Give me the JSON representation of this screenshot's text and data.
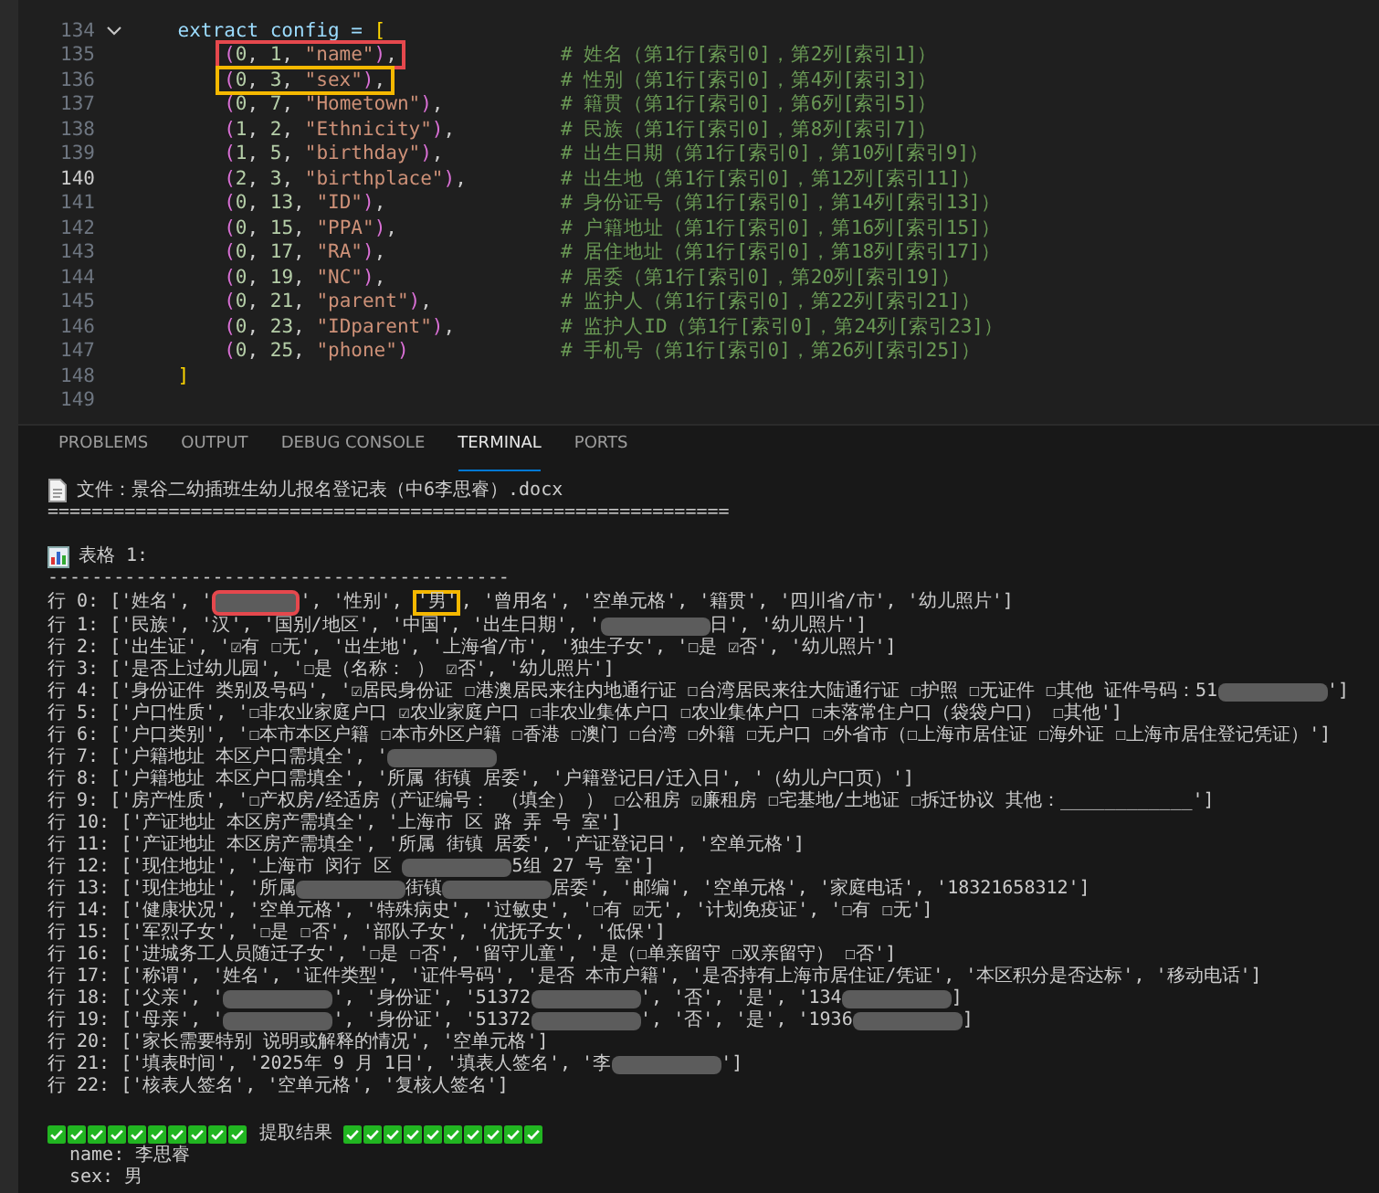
{
  "editor": {
    "lines": [
      {
        "number": "134",
        "code": "    extract_config = [",
        "foldable": true,
        "current": false
      },
      {
        "number": "135",
        "boxed": "(0, 1, \"name\"),",
        "color": "#e5484d",
        "comment": "# 姓名（第1行[索引0]，第2列[索引1]）",
        "current": false
      },
      {
        "number": "136",
        "boxed": "(0, 3, \"sex\"),",
        "color": "#f5b800",
        "comment": "# 性别（第1行[索引0]，第4列[索引3]）",
        "current": false
      },
      {
        "number": "137",
        "code": "        (0, 7, \"Hometown\"),",
        "comment": "# 籍贯（第1行[索引0]，第6列[索引5]）",
        "current": false
      },
      {
        "number": "138",
        "code": "        (1, 2, \"Ethnicity\"),",
        "comment": "# 民族（第1行[索引0]，第8列[索引7]）",
        "current": false
      },
      {
        "number": "139",
        "code": "        (1, 5, \"birthday\"),",
        "comment": "# 出生日期（第1行[索引0]，第10列[索引9]）",
        "current": false
      },
      {
        "number": "140",
        "code": "        (2, 3, \"birthplace\"),",
        "comment": "# 出生地（第1行[索引0]，第12列[索引11]）",
        "current": true
      },
      {
        "number": "141",
        "code": "        (0, 13, \"ID\"),",
        "comment": "# 身份证号（第1行[索引0]，第14列[索引13]）",
        "current": false
      },
      {
        "number": "142",
        "code": "        (0, 15, \"PPA\"),",
        "comment": "# 户籍地址（第1行[索引0]，第16列[索引15]）",
        "current": false
      },
      {
        "number": "143",
        "code": "        (0, 17, \"RA\"),",
        "comment": "# 居住地址（第1行[索引0]，第18列[索引17]）",
        "current": false
      },
      {
        "number": "144",
        "code": "        (0, 19, \"NC\"),",
        "comment": "# 居委（第1行[索引0]，第20列[索引19]）",
        "current": false
      },
      {
        "number": "145",
        "code": "        (0, 21, \"parent\"),",
        "comment": "# 监护人（第1行[索引0]，第22列[索引21]）",
        "current": false
      },
      {
        "number": "146",
        "code": "        (0, 23, \"IDparent\"),",
        "comment": "# 监护人ID（第1行[索引0]，第24列[索引23]）",
        "current": false
      },
      {
        "number": "147",
        "code": "        (0, 25, \"phone\")",
        "comment": "# 手机号（第1行[索引0]，第26列[索引25]）",
        "current": false
      },
      {
        "number": "148",
        "code": "    ]",
        "current": false
      },
      {
        "number": "149",
        "current": false
      }
    ]
  },
  "panel": {
    "tabs": [
      {
        "label": "PROBLEMS",
        "selected": false
      },
      {
        "label": "OUTPUT",
        "selected": false
      },
      {
        "label": "DEBUG CONSOLE",
        "selected": false
      },
      {
        "label": "TERMINAL",
        "selected": true
      },
      {
        "label": "PORTS",
        "selected": false
      }
    ]
  },
  "terminal": {
    "file_line": "文件：景谷二幼插班生幼儿报名登记表（中6李思睿）.docx",
    "double_rule": "==============================================================",
    "table_title": "表格 1:",
    "single_rule": "------------------------------------------",
    "lines": [
      {
        "parts": [
          {
            "kind": "text",
            "text": "行 0: ['姓名', '"
          },
          {
            "kind": "redacted",
            "color": "#e5484d"
          },
          {
            "kind": "text",
            "text": "', '性别', "
          },
          {
            "kind": "text",
            "text": "'男'",
            "color": "#f5b800"
          },
          {
            "kind": "text",
            "text": ", '曾用名', '空单元格', '籍贯', '四川省/市', '幼儿照片']"
          }
        ]
      },
      {
        "parts": [
          {
            "kind": "text",
            "text": "行 1: ['民族', '汉', '国别/地区', '中国', '出生日期', '"
          },
          {
            "kind": "redacted"
          },
          {
            "kind": "text",
            "text": "日', '幼儿照片']"
          }
        ]
      },
      {
        "parts": [
          {
            "kind": "text",
            "text": "行 2: ['出生证', '☑有 ☐无', '出生地', '上海省/市', '独生子女', '☐是 ☑否', '幼儿照片']"
          }
        ]
      },
      {
        "parts": [
          {
            "kind": "text",
            "text": "行 3: ['是否上过幼儿园', '☐是（名称： ） ☑否', '幼儿照片']"
          }
        ]
      },
      {
        "parts": [
          {
            "kind": "text",
            "text": "行 4: ['身份证件 类别及号码', '☑居民身份证 ☐港澳居民来往内地通行证 ☐台湾居民来往大陆通行证 ☐护照 ☐无证件 ☐其他 证件号码：51"
          },
          {
            "kind": "redacted"
          },
          {
            "kind": "text",
            "text": "']"
          }
        ]
      },
      {
        "parts": [
          {
            "kind": "text",
            "text": "行 5: ['户口性质', '☐非农业家庭户口 ☑农业家庭户口 ☐非农业集体户口 ☐农业集体户口 ☐未落常住户口（袋袋户口） ☐其他']"
          }
        ]
      },
      {
        "parts": [
          {
            "kind": "text",
            "text": "行 6: ['户口类别', '☐本市本区户籍 ☐本市外区户籍 ☐香港 ☐澳门 ☐台湾 ☐外籍 ☐无户口 ☐外省市（☐上海市居住证 ☐海外证 ☐上海市居住登记凭证）']"
          }
        ]
      },
      {
        "parts": [
          {
            "kind": "text",
            "text": "行 7: ['户籍地址 本区户口需填全', '"
          },
          {
            "kind": "redacted"
          }
        ]
      },
      {
        "parts": [
          {
            "kind": "text",
            "text": "行 8: ['户籍地址 本区户口需填全', '所属 街镇 居委', '户籍登记日/迁入日', '（幼儿户口页）']"
          }
        ]
      },
      {
        "parts": [
          {
            "kind": "text",
            "text": "行 9: ['房产性质', '☐产权房/经适房（产证编号： （填全） ） ☐公租房 ☑廉租房 ☐宅基地/土地证 ☐拆迁协议 其他：____________']"
          }
        ]
      },
      {
        "parts": [
          {
            "kind": "text",
            "text": "行 10: ['产证地址 本区房产需填全', '上海市 区 路 弄 号 室']"
          }
        ]
      },
      {
        "parts": [
          {
            "kind": "text",
            "text": "行 11: ['产证地址 本区房产需填全', '所属 街镇 居委', '产证登记日', '空单元格']"
          }
        ]
      },
      {
        "parts": [
          {
            "kind": "text",
            "text": "行 12: ['现住地址', '上海市 闵行 区 "
          },
          {
            "kind": "redacted"
          },
          {
            "kind": "text",
            "text": "5组 27 号 室']"
          }
        ]
      },
      {
        "parts": [
          {
            "kind": "text",
            "text": "行 13: ['现住地址', '所属"
          },
          {
            "kind": "redacted"
          },
          {
            "kind": "text",
            "text": "街镇"
          },
          {
            "kind": "redacted"
          },
          {
            "kind": "text",
            "text": "居委', '邮编', '空单元格', '家庭电话', '18321658312']"
          }
        ]
      },
      {
        "parts": [
          {
            "kind": "text",
            "text": "行 14: ['健康状况', '空单元格', '特殊病史', '过敏史', '☐有 ☑无', '计划免疫证', '☐有 ☐无']"
          }
        ]
      },
      {
        "parts": [
          {
            "kind": "text",
            "text": "行 15: ['军烈子女', '☐是 ☐否', '部队子女', '优抚子女', '低保']"
          }
        ]
      },
      {
        "parts": [
          {
            "kind": "text",
            "text": "行 16: ['进城务工人员随迁子女', '☐是 ☐否', '留守儿童', '是（☐单亲留守 ☐双亲留守） ☐否']"
          }
        ]
      },
      {
        "parts": [
          {
            "kind": "text",
            "text": "行 17: ['称谓', '姓名', '证件类型', '证件号码', '是否 本市户籍', '是否持有上海市居住证/凭证', '本区积分是否达标', '移动电话']"
          }
        ]
      },
      {
        "parts": [
          {
            "kind": "text",
            "text": "行 18: ['父亲', '"
          },
          {
            "kind": "redacted"
          },
          {
            "kind": "text",
            "text": "', '身份证', '51372"
          },
          {
            "kind": "redacted"
          },
          {
            "kind": "text",
            "text": "', '否', '是', '134"
          },
          {
            "kind": "redacted"
          },
          {
            "kind": "text",
            "text": "]"
          }
        ]
      },
      {
        "parts": [
          {
            "kind": "text",
            "text": "行 19: ['母亲', '"
          },
          {
            "kind": "redacted"
          },
          {
            "kind": "text",
            "text": "', '身份证', '51372"
          },
          {
            "kind": "redacted"
          },
          {
            "kind": "text",
            "text": "', '否', '是', '1936"
          },
          {
            "kind": "redacted"
          },
          {
            "kind": "text",
            "text": "]"
          }
        ]
      },
      {
        "parts": [
          {
            "kind": "text",
            "text": "行 20: ['家长需要特别 说明或解释的情况', '空单元格']"
          }
        ]
      },
      {
        "parts": [
          {
            "kind": "text",
            "text": "行 21: ['填表时间', '2025年 9 月 1日', '填表人签名', '李"
          },
          {
            "kind": "redacted"
          },
          {
            "kind": "text",
            "text": "']"
          }
        ]
      },
      {
        "parts": [
          {
            "kind": "text",
            "text": "行 22: ['核表人签名', '空单元格', '复核人签名']"
          }
        ]
      }
    ],
    "result_title": "提取结果",
    "results": [
      "name: 李思睿",
      "sex: 男"
    ]
  }
}
